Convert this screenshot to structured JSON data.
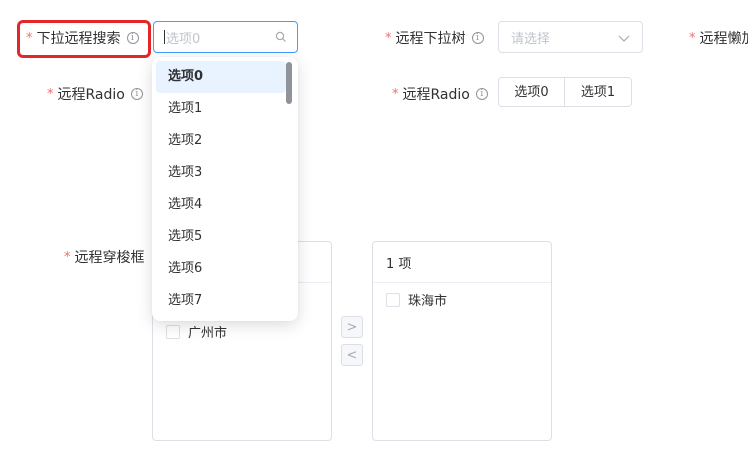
{
  "required_mark": "*",
  "info_glyph": "i",
  "colors": {
    "accent": "#409eff",
    "required": "#f56c6c",
    "highlight": "#e4262b"
  },
  "row1": {
    "remote_search": {
      "label": "下拉远程搜索",
      "placeholder": "选项0"
    },
    "remote_tree": {
      "label": "远程下拉树",
      "placeholder": "请选择"
    },
    "remote_lazy": {
      "label": "远程懒加"
    }
  },
  "dropdown": {
    "options": [
      "选项0",
      "选项1",
      "选项2",
      "选项3",
      "选项4",
      "选项5",
      "选项6",
      "选项7"
    ],
    "selected_index": 0
  },
  "row2": {
    "radio_left": {
      "label": "远程Radio"
    },
    "radio_right": {
      "label": "远程Radio",
      "options": [
        "选项0",
        "选项1"
      ]
    }
  },
  "transfer": {
    "label": "远程穿梭框",
    "left_items": [
      "广州市"
    ],
    "right_header": "1 项",
    "right_items": [
      "珠海市"
    ],
    "to_right_glyph": ">",
    "to_left_glyph": "<"
  }
}
